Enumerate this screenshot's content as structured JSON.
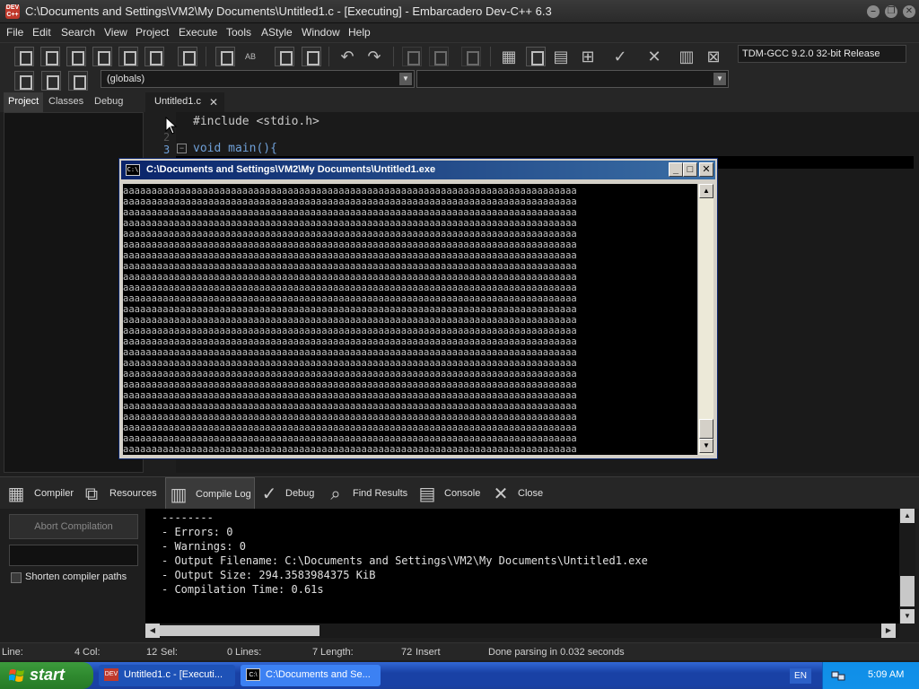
{
  "window": {
    "icon_label": "DEV C++",
    "title": "C:\\Documents and Settings\\VM2\\My Documents\\Untitled1.c - [Executing] - Embarcadero Dev-C++ 6.3"
  },
  "menu": [
    "File",
    "Edit",
    "Search",
    "View",
    "Project",
    "Execute",
    "Tools",
    "AStyle",
    "Window",
    "Help"
  ],
  "toolbar": {
    "compiler": "TDM-GCC 9.2.0 32-bit Release",
    "scope_combo": "(globals)"
  },
  "left_tabs": [
    "Project",
    "Classes",
    "Debug"
  ],
  "editor": {
    "tab_label": "Untitled1.c",
    "tab_close": "✕",
    "line_numbers": [
      "1",
      "2",
      "3"
    ],
    "lines": [
      "#include <stdio.h>",
      "",
      "void main(){"
    ]
  },
  "console": {
    "icon_label": "C:\\",
    "title": "C:\\Documents and Settings\\VM2\\My Documents\\Untitled1.exe",
    "minimize": "_",
    "maximize": "□",
    "close": "✕",
    "output_char": "a",
    "columns": 80,
    "rows": 25
  },
  "bottom_tabs": [
    "Compiler",
    "Resources",
    "Compile Log",
    "Debug",
    "Find Results",
    "Console",
    "Close"
  ],
  "bottom": {
    "abort_label": "Abort Compilation",
    "shorten_label": "Shorten compiler paths",
    "log": [
      "--------",
      "- Errors: 0",
      "- Warnings: 0",
      "- Output Filename: C:\\Documents and Settings\\VM2\\My Documents\\Untitled1.exe",
      "- Output Size: 294.3583984375 KiB",
      "- Compilation Time: 0.61s"
    ]
  },
  "status": {
    "line_label": "Line:",
    "line_value": "4",
    "col_label": "Col:",
    "col_value": "12",
    "sel_label": "Sel:",
    "sel_value": "0",
    "lines_label": "Lines:",
    "lines_value": "7",
    "length_label": "Length:",
    "length_value": "72",
    "mode": "Insert",
    "message": "Done parsing in 0.032 seconds"
  },
  "taskbar": {
    "start": "start",
    "tasks": [
      {
        "icon": "DEV",
        "label": "Untitled1.c - [Executi..."
      },
      {
        "icon": "C:\\",
        "label": "C:\\Documents and Se..."
      }
    ],
    "language": "EN",
    "clock": "5:09 AM"
  },
  "colors": {
    "keyword": "#6fa0d8",
    "xp_title": "#0a246a",
    "taskbar": "#1941a5",
    "start": "#2f8a2f"
  }
}
